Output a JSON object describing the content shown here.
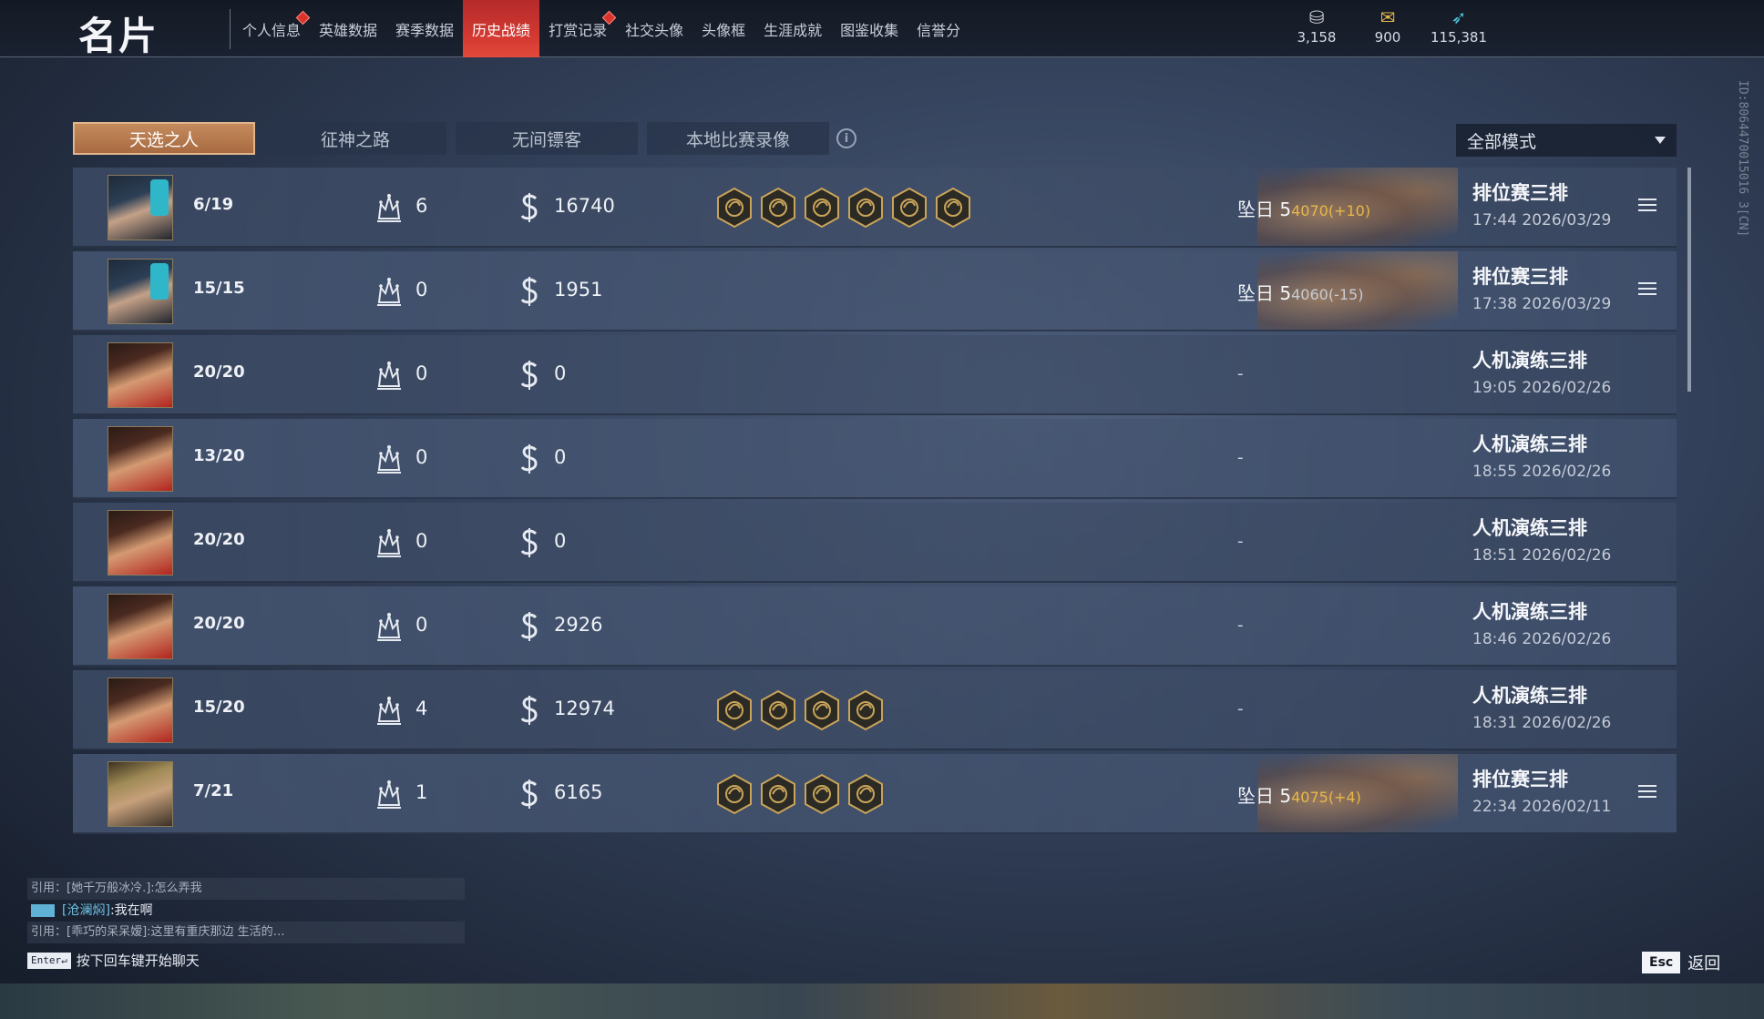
{
  "header": {
    "title": "名片",
    "nav": [
      {
        "label": "个人信息",
        "badge": true,
        "active": false
      },
      {
        "label": "英雄数据",
        "badge": false,
        "active": false
      },
      {
        "label": "赛季数据",
        "badge": false,
        "active": false
      },
      {
        "label": "历史战绩",
        "badge": false,
        "active": true
      },
      {
        "label": "打赏记录",
        "badge": true,
        "active": false
      },
      {
        "label": "社交头像",
        "badge": false,
        "active": false
      },
      {
        "label": "头像框",
        "badge": false,
        "active": false
      },
      {
        "label": "生涯成就",
        "badge": false,
        "active": false
      },
      {
        "label": "图鉴收集",
        "badge": false,
        "active": false
      },
      {
        "label": "信誉分",
        "badge": false,
        "active": false
      }
    ],
    "currencies": [
      {
        "icon": "gold-ingot-icon",
        "value": "3,158"
      },
      {
        "icon": "treasure-icon",
        "value": "900"
      },
      {
        "icon": "feather-icon",
        "value": "115,381"
      }
    ]
  },
  "side_id": "ID:8064470015016 3[CN]",
  "tabs": [
    {
      "label": "天选之人",
      "active": true
    },
    {
      "label": "征神之路",
      "active": false
    },
    {
      "label": "无间镖客",
      "active": false
    },
    {
      "label": "本地比赛录像",
      "active": false
    }
  ],
  "mode_select": {
    "value": "全部模式"
  },
  "matches": [
    {
      "avatar": "a1",
      "rank": "6/19",
      "kills": "6",
      "coins": "16740",
      "badges": [
        "beast-badge-icon",
        "serpent-badge-icon",
        "dragon-badge-icon",
        "swirl-badge-icon",
        "trident-badge-icon",
        "helmet-badge-icon"
      ],
      "tier": "坠日 5",
      "score": "4070(+10)",
      "score_neg": false,
      "mode": "排位赛三排",
      "time": "17:44  2026/03/29",
      "has_detail": true
    },
    {
      "avatar": "a1",
      "rank": "15/15",
      "kills": "0",
      "coins": "1951",
      "badges": [],
      "tier": "坠日 5",
      "score": "4060(-15)",
      "score_neg": true,
      "mode": "排位赛三排",
      "time": "17:38  2026/03/29",
      "has_detail": true
    },
    {
      "avatar": "a2",
      "rank": "20/20",
      "kills": "0",
      "coins": "0",
      "badges": [],
      "tier": "",
      "score": "",
      "dash": "-",
      "mode": "人机演练三排",
      "time": "19:05  2026/02/26",
      "has_detail": false
    },
    {
      "avatar": "a2",
      "rank": "13/20",
      "kills": "0",
      "coins": "0",
      "badges": [],
      "tier": "",
      "score": "",
      "dash": "-",
      "mode": "人机演练三排",
      "time": "18:55  2026/02/26",
      "has_detail": false
    },
    {
      "avatar": "a2",
      "rank": "20/20",
      "kills": "0",
      "coins": "0",
      "badges": [],
      "tier": "",
      "score": "",
      "dash": "-",
      "mode": "人机演练三排",
      "time": "18:51  2026/02/26",
      "has_detail": false
    },
    {
      "avatar": "a2",
      "rank": "20/20",
      "kills": "0",
      "coins": "2926",
      "badges": [],
      "tier": "",
      "score": "",
      "dash": "-",
      "mode": "人机演练三排",
      "time": "18:46  2026/02/26",
      "has_detail": false
    },
    {
      "avatar": "a2",
      "rank": "15/20",
      "kills": "4",
      "coins": "12974",
      "badges": [
        "serpent-badge-icon",
        "swirl-badge-icon",
        "trident-badge-icon",
        "dragon-badge-icon"
      ],
      "tier": "",
      "score": "",
      "dash": "-",
      "mode": "人机演练三排",
      "time": "18:31  2026/02/26",
      "has_detail": false
    },
    {
      "avatar": "a3",
      "rank": "7/21",
      "kills": "1",
      "coins": "6165",
      "badges": [
        "swirl-badge-icon",
        "helmet-badge-icon",
        "dragon-badge-icon",
        "trident-badge-icon"
      ],
      "tier": "坠日 5",
      "score": "4075(+4)",
      "score_neg": false,
      "mode": "排位赛三排",
      "time": "22:34  2026/02/11",
      "has_detail": true
    }
  ],
  "chat": {
    "lines": [
      {
        "text": "引用：[她千万般冰冷.]:怎么弄我",
        "main": false
      },
      {
        "who": "[沧澜焖]",
        "text": ":我在啊",
        "main": true
      },
      {
        "text": "引用：[乖巧的呆呆嫒]:这里有重庆那边 生活的…",
        "main": false
      }
    ],
    "enter_key": "Enter↵",
    "hint": "按下回车键开始聊天"
  },
  "footer": {
    "esc_key": "Esc",
    "back_label": "返回"
  },
  "colors": {
    "accent_red": "#d63b33",
    "tab_gold": "#b77a4e",
    "score_gold": "#e8b84a"
  }
}
